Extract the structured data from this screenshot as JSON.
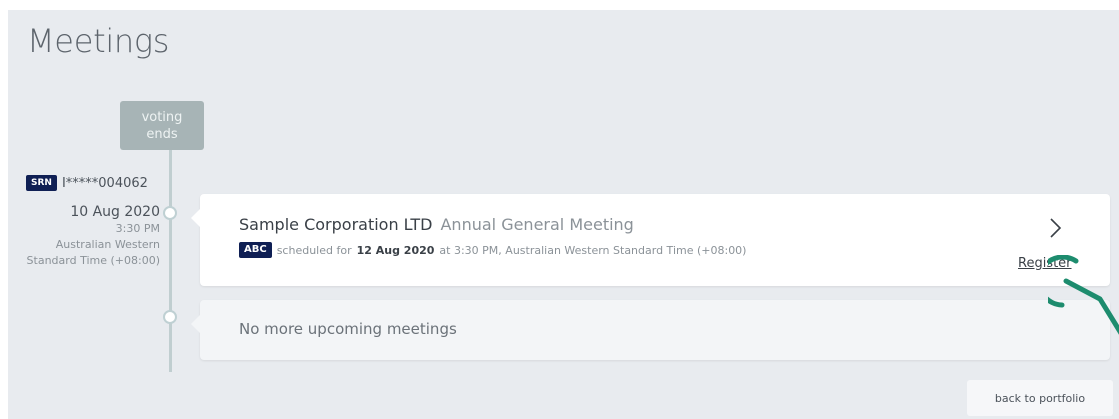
{
  "page": {
    "title": "Meetings"
  },
  "timeline": {
    "marker_line1": "voting",
    "marker_line2": "ends"
  },
  "holding": {
    "srn_badge": "SRN",
    "srn_value": "I*****004062"
  },
  "event": {
    "date": "10 Aug 2020",
    "time": "3:30 PM",
    "timezone_line1": "Australian Western",
    "timezone_line2": "Standard Time (+08:00)"
  },
  "meeting": {
    "company": "Sample Corporation LTD",
    "type": "Annual General Meeting",
    "badge": "ABC",
    "scheduled_prefix": "scheduled for",
    "scheduled_date": "12 Aug 2020",
    "scheduled_suffix": "at 3:30 PM, Australian Western Standard Time (+08:00)",
    "action_label": "Register"
  },
  "empty_state": {
    "text": "No more upcoming meetings"
  },
  "footer": {
    "back_label": "back to portfolio"
  },
  "colors": {
    "background": "#e8ebef",
    "badge_navy": "#0f1f54",
    "timeline": "#c0ced0",
    "marker": "#a7b4b6",
    "cursor_ring": "#1d8c6e"
  },
  "icons": {
    "chevron": "chevron-right-icon",
    "cursor": "pointer-cursor-icon"
  }
}
